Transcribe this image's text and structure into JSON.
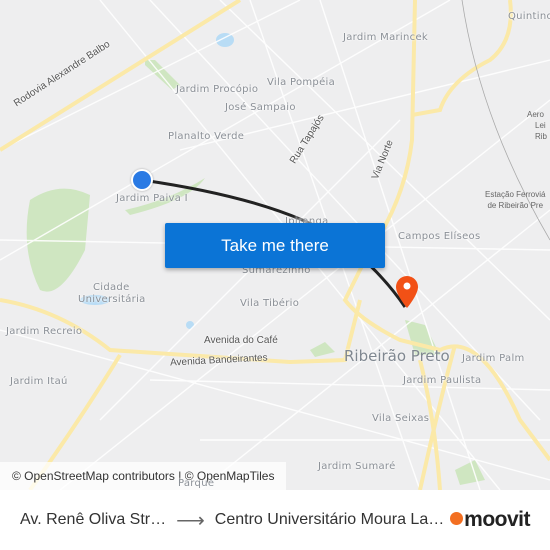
{
  "map": {
    "labels": {
      "quintino": "Quintino",
      "jardim_marincek": "Jardim Marincek",
      "vila_pompeia": "Vila Pompéia",
      "jardim_procopio": "Jardim Procópio",
      "jose_sampaio": "José Sampaio",
      "planalto_verde": "Planalto Verde",
      "jardim_paiva": "Jardim Paiva I",
      "ipiranga": "Ipiranga",
      "campos_eliseos": "Campos Elíseos",
      "sumarezinho": "Sumarezinho",
      "cidade_universitaria_1": "Cidade",
      "cidade_universitaria_2": "Universitária",
      "vila_tiberio": "Vila Tibério",
      "jardim_recreio": "Jardim Recreio",
      "jardim_itau": "Jardim Itaú",
      "jardim_palm": "Jardim Palm",
      "jardim_paulista": "Jardim Paulista",
      "vila_seixas": "Vila Seixas",
      "jardim_sumare": "Jardim Sumaré",
      "parque": "Parque",
      "city": "Ribeirão Preto"
    },
    "roads": {
      "rodovia": "Rodovia Alexandre Balbo",
      "rua_tapajos": "Rua Tapajós",
      "via_norte": "Via Norte",
      "av_cafe": "Avenida do Café",
      "av_bandeirantes": "Avenida Bandeirantes"
    },
    "pois": {
      "aeroporto_1": "Aero",
      "aeroporto_2": "Lei",
      "aeroporto_3": "Rib",
      "estacao_1": "Estação Ferroviá",
      "estacao_2": "de Ribeirão Pre"
    },
    "attribution": "© OpenStreetMap contributors | © OpenMapTiles",
    "colors": {
      "route": "#222222",
      "origin": "#2a7ae4",
      "destination": "#f25116",
      "button": "#0b74d6"
    }
  },
  "cta": {
    "label": "Take me there"
  },
  "footer": {
    "origin": "Av. Renê Oliva Str…",
    "destination": "Centro Universitário Moura La…",
    "brand": "moovit"
  }
}
